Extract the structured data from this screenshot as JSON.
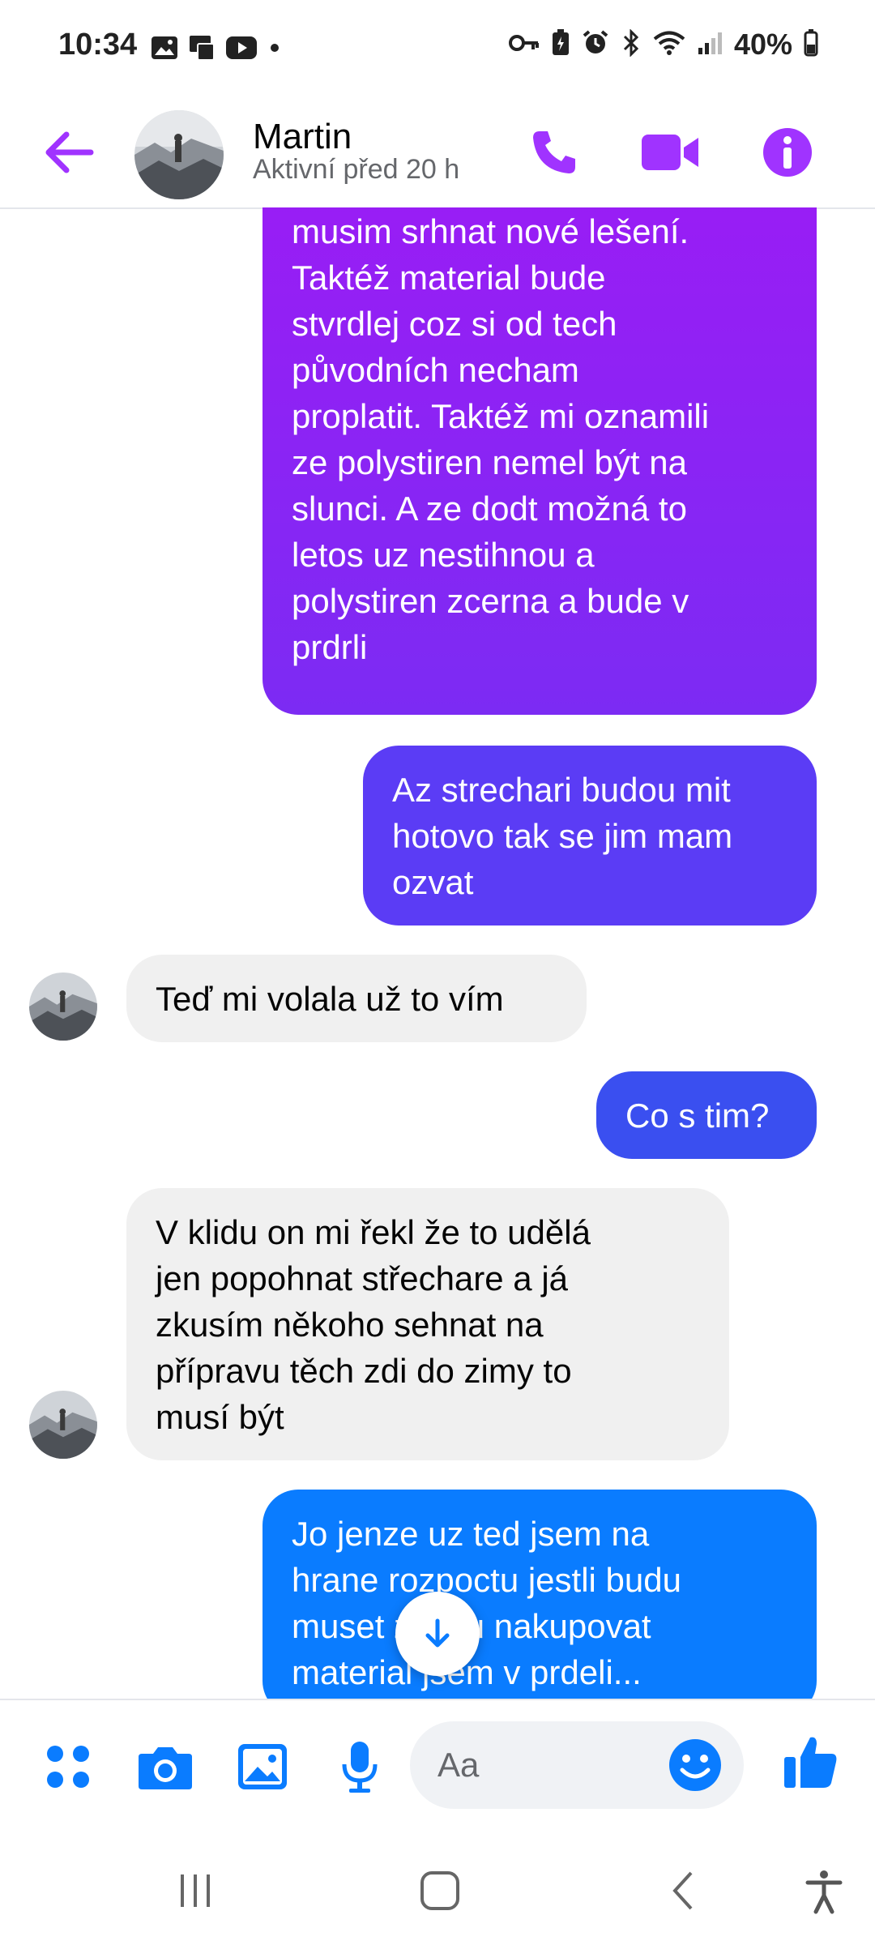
{
  "status_bar": {
    "time": "10:34",
    "battery": "40%",
    "left_icons": [
      "gallery-icon",
      "cast-icon",
      "youtube-icon",
      "dot-icon"
    ],
    "right_icons": [
      "key-icon",
      "battery-saver-icon",
      "alarm-icon",
      "bluetooth-icon",
      "wifi-icon",
      "signal-icon"
    ]
  },
  "header": {
    "contact_name": "Martin",
    "contact_status": "Aktivní před 20 h"
  },
  "colors": {
    "accent": "#a033ff",
    "bubble_purple_top": "#9b1cf5",
    "bubble_purple_bottom": "#7c2bf3",
    "bubble_violet": "#5b3cf5",
    "bubble_indigo": "#3a4ff0",
    "bubble_blue": "#0a7cff",
    "composer_icons": "#0a7cff"
  },
  "messages": [
    {
      "direction": "outgoing",
      "text": "udělají celou střechu,tudíž\nmusim srhnat nové lešení.\nTaktéž material bude\nstvrdlej coz si od tech\npůvodních necham\nproplatit. Taktéž mi oznamili\nze polystiren nemel být na\nslunci. A ze dodt možná to\nletos uz nestihnou a\npolystiren zcerna a bude v\nprdrli"
    },
    {
      "direction": "outgoing",
      "text": "Az strechari budou mit\nhotovo tak se jim mam\nozvat"
    },
    {
      "direction": "incoming",
      "text": "Teď mi volala už to vím"
    },
    {
      "direction": "outgoing",
      "text": "Co s tim?"
    },
    {
      "direction": "incoming",
      "text": "V klidu on mi řekl že to udělá\njen popohnat střechare a já\nzkusím někoho sehnat na\npřípravu těch zdi do zimy to\nmusí být"
    },
    {
      "direction": "outgoing",
      "text": "Jo jenze uz ted jsem na\nhrane rozpoctu jestli budu\nmuset znovu nakupovat\nmaterial jsem v prdeli..."
    }
  ],
  "composer": {
    "placeholder": "Aa"
  }
}
